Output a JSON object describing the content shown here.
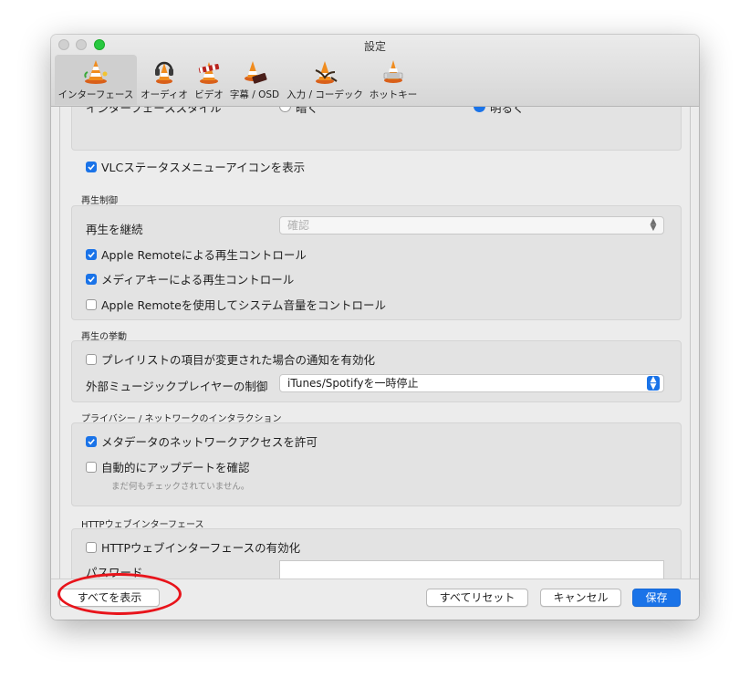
{
  "window": {
    "title": "設定"
  },
  "toolbar": {
    "tabs": [
      {
        "label": "インターフェース",
        "icon": "vlc-cone-icon"
      },
      {
        "label": "オーディオ",
        "icon": "vlc-cone-headphones-icon"
      },
      {
        "label": "ビデオ",
        "icon": "vlc-cone-clapper-icon"
      },
      {
        "label": "字幕 / OSD",
        "icon": "vlc-cone-subtitle-icon"
      },
      {
        "label": "入力 / コーデック",
        "icon": "vlc-cone-cables-icon"
      },
      {
        "label": "ホットキー",
        "icon": "vlc-cone-keyboard-icon"
      }
    ]
  },
  "interface_section": {
    "clipped_label": "インターフェーススタイル",
    "radio_dark": "暗く",
    "radio_bright": "明るく",
    "vlc_status_menu": {
      "label": "VLCステータスメニューアイコンを表示",
      "checked": true
    }
  },
  "playback_control": {
    "title": "再生制御",
    "continue_label": "再生を継続",
    "continue_value": "確認",
    "apple_remote": {
      "label": "Apple Remoteによる再生コントロール",
      "checked": true
    },
    "media_keys": {
      "label": "メディアキーによる再生コントロール",
      "checked": true
    },
    "apple_remote_volume": {
      "label": "Apple Remoteを使用してシステム音量をコントロール",
      "checked": false
    }
  },
  "playback_behavior": {
    "title": "再生の挙動",
    "playlist_notify": {
      "label": "プレイリストの項目が変更された場合の通知を有効化",
      "checked": false
    },
    "external_player_label": "外部ミュージックプレイヤーの制御",
    "external_player_value": "iTunes/Spotifyを一時停止"
  },
  "privacy": {
    "title": "プライバシー / ネットワークのインタラクション",
    "metadata_access": {
      "label": "メタデータのネットワークアクセスを許可",
      "checked": true
    },
    "auto_update": {
      "label": "自動的にアップデートを確認",
      "checked": false
    },
    "hint": "まだ何もチェックされていません。"
  },
  "http_interface": {
    "title": "HTTPウェブインターフェース",
    "enable": {
      "label": "HTTPウェブインターフェースの有効化",
      "checked": false
    },
    "password_label": "パスワード",
    "password_value": ""
  },
  "footer": {
    "show_all": "すべてを表示",
    "reset_all": "すべてリセット",
    "cancel": "キャンセル",
    "save": "保存"
  },
  "colors": {
    "accent": "#1a73e8",
    "annotation": "#e8141b",
    "zoom_button": "#28c840"
  }
}
